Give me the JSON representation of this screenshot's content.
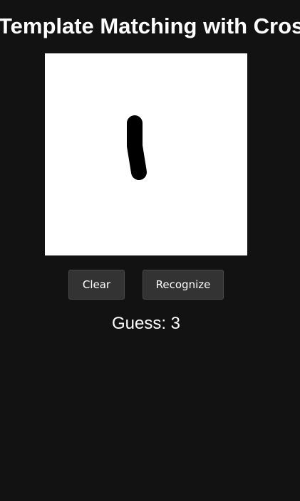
{
  "page": {
    "title": "Template Matching with Cross-Correlation"
  },
  "canvas": {
    "background": "#ffffff",
    "stroke_color": "#000000"
  },
  "buttons": {
    "clear_label": "Clear",
    "recognize_label": "Recognize"
  },
  "result": {
    "prefix": "Guess: ",
    "value": "3",
    "text": "Guess: 3"
  },
  "colors": {
    "background": "#121212",
    "button_bg": "#333333",
    "text": "#ffffff"
  }
}
